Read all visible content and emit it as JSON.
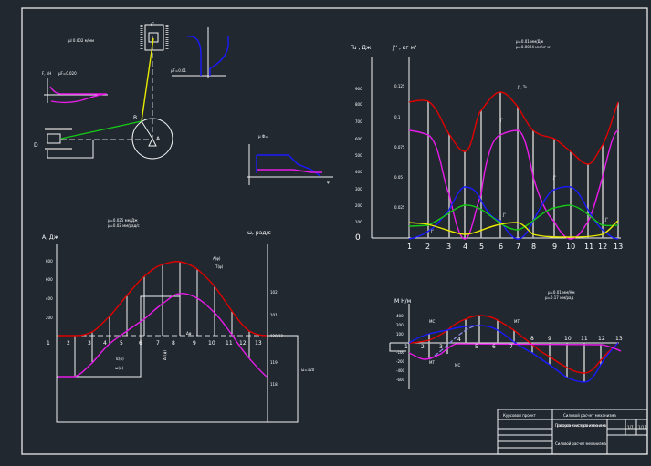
{
  "mechanism": {
    "scale_label": "μl 0.002 м/мм",
    "point_c": "C",
    "point_b": "B",
    "point_a": "A",
    "point_d": "D",
    "force_label_left": "F, кН",
    "force_scale_left": "μF=0.020",
    "force_label_top": "F, кН",
    "force_scale_top": "μF=0.01",
    "small_chart_label": "μ Ф=",
    "small_chart_axis": "φ"
  },
  "energy_chart": {
    "title_left": "A, Дж",
    "title_right": "ω, рад/с",
    "scale_lines": [
      "μ=0.025 мм/Дж",
      "μ=0.02 мм/рад/с"
    ],
    "legend_top": [
      "A(φ)",
      "T(φ)"
    ],
    "legend_bottom": [
      "Tc(φ)",
      "ω(φ)"
    ],
    "delta_label": "ΔT(φ)",
    "baseline_label": "Δφ",
    "right_ticks": [
      "102",
      "101",
      "120/12",
      "119",
      "118"
    ],
    "left_ticks": [
      "800",
      "600",
      "400",
      "200"
    ],
    "side_label": "ω=120",
    "x_labels": [
      "1",
      "2",
      "3",
      "4",
      "5",
      "6",
      "7",
      "8",
      "9",
      "10",
      "11",
      "12",
      "13"
    ]
  },
  "inertia_chart": {
    "title_left": "Tu , Дж",
    "title_mid": "J'' , кг·м²",
    "scale_lines": [
      "μ=0.01 мм/Дж",
      "μ=0.0004 мм/кг·м²"
    ],
    "left_ticks": [
      "100",
      "200",
      "300",
      "400",
      "500",
      "600",
      "700",
      "800",
      "900"
    ],
    "mid_ticks": [
      "0.025",
      "0.05",
      "0.075",
      "0.1",
      "0.125"
    ],
    "zero": "0",
    "curve_labels": [
      "J'', Tu",
      "J''",
      "J''",
      "J''",
      "J''",
      "J''"
    ],
    "x_labels": [
      "1",
      "2",
      "3",
      "4",
      "5",
      "6",
      "7",
      "8",
      "9",
      "10",
      "11",
      "12",
      "13"
    ]
  },
  "moment_chart": {
    "title": "M Н/м",
    "scale_lines": [
      "μ=0.01 мм/Нм",
      "μ=0.17 мм/рад"
    ],
    "ticks": [
      "400",
      "200",
      "100",
      "-100",
      "-200",
      "-400",
      "-600"
    ],
    "curve_labels": [
      "MC",
      "MT",
      "MT",
      "MC"
    ],
    "x_labels": [
      "1",
      "2",
      "3",
      "4",
      "5",
      "6",
      "7",
      "8",
      "9",
      "10",
      "11",
      "12",
      "13"
    ]
  },
  "title_block": {
    "course": "Курсовой проект",
    "header": "Силовой расчет механизма",
    "title": "Проектирование и исследование механизмов",
    "subtitle": "Силовой расчет механизма",
    "sheet": "1/7",
    "sheets": "1/11"
  },
  "colors": {
    "red": "#e00000",
    "magenta": "#e81be8",
    "blue": "#1a1aff",
    "green": "#16c816",
    "yellow": "#e8e800",
    "background": "#212830"
  }
}
